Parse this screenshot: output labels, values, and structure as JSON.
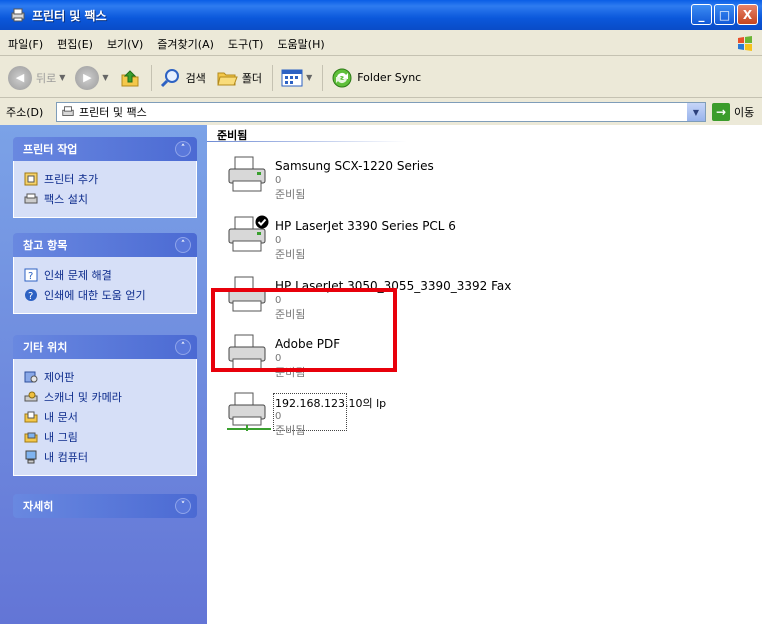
{
  "window": {
    "title": "프린터 및 팩스",
    "minimize": "_",
    "maximize": "□",
    "close": "X"
  },
  "menu": [
    "파일(F)",
    "편집(E)",
    "보기(V)",
    "즐겨찾기(A)",
    "도구(T)",
    "도움말(H)"
  ],
  "toolbar": {
    "back": "뒤로",
    "search": "검색",
    "folders": "폴더",
    "folder_sync": "Folder Sync"
  },
  "address": {
    "label": "주소(D)",
    "value": "프린터 및 팩스",
    "go": "이동"
  },
  "sidebar": {
    "printer_tasks": {
      "title": "프린터 작업",
      "links": [
        "프린터 추가",
        "팩스 설치"
      ]
    },
    "see_also": {
      "title": "참고 항목",
      "links": [
        "인쇄 문제 해결",
        "인쇄에 대한 도움 얻기"
      ]
    },
    "other_places": {
      "title": "기타 위치",
      "links": [
        "제어판",
        "스캐너 및 카메라",
        "내 문서",
        "내 그림",
        "내 컴퓨터"
      ]
    },
    "details": {
      "title": "자세히"
    }
  },
  "content": {
    "group_header": "준비됨",
    "printers": [
      {
        "name": "Samsung SCX-1220 Series",
        "docs": "0",
        "status": "준비됨"
      },
      {
        "name": "HP LaserJet 3390 Series PCL 6",
        "docs": "0",
        "status": "준비됨"
      },
      {
        "name": "HP LaserJet 3050_3055_3390_3392 Fax",
        "docs": "0",
        "status": "준비됨"
      },
      {
        "name": "Adobe PDF",
        "docs": "0",
        "status": "준비됨"
      },
      {
        "name": "192.168.123.10의 lp",
        "docs": "0",
        "status": "준비됨"
      }
    ]
  },
  "colors": {
    "highlight": "#E8000B",
    "titlebar": "#0A5DE6",
    "sidebar": "#7BA2E7"
  }
}
